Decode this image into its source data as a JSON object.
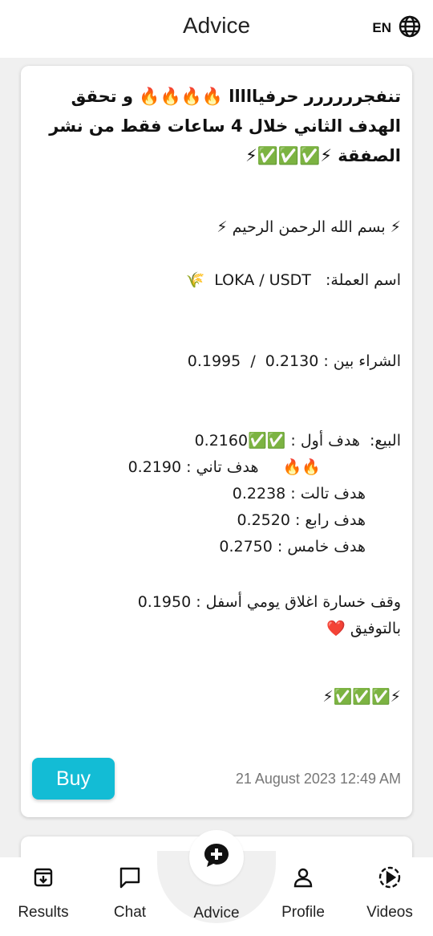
{
  "header": {
    "title": "Advice",
    "lang": "EN",
    "lang_icon": "globe-icon"
  },
  "post": {
    "headline": [
      "تنفجرررررر حرفيااااا 🔥🔥🔥🔥 و تحقق",
      "الهدف الثاني خلال 4 ساعات فقط من نشر",
      "الصفقة ⚡✅✅✅⚡"
    ],
    "lines": [
      "⚡ بسم الله الرحمن الرحيم ⚡",
      "اسم العملة:   LOKA / USDT  🌾",
      "الشراء بين : 0.2130  /  0.1995",
      "البيع:  هدف أول : ✅✅0.2160",
      "🔥🔥     هدف تاني : 0.2190",
      "هدف تالت : 0.2238",
      "هدف رابع : 0.2520",
      "هدف خامس : 0.2750",
      "وقف خسارة اغلاق يومي أسفل : 0.1950",
      "بالتوفيق ❤️",
      "⚡✅✅✅⚡"
    ],
    "buy_label": "Buy",
    "date": "21 August 2023 12:49 AM"
  },
  "nav": {
    "items": [
      {
        "label": "Results",
        "icon": "archive-icon"
      },
      {
        "label": "Chat",
        "icon": "chat-icon"
      },
      {
        "label": "Advice",
        "icon": "advice-plus-icon"
      },
      {
        "label": "Profile",
        "icon": "person-icon"
      },
      {
        "label": "Videos",
        "icon": "play-circle-icon"
      }
    ]
  },
  "colors": {
    "accent": "#13bcd5",
    "check": "#46b035",
    "fire": "#f06a0c"
  }
}
